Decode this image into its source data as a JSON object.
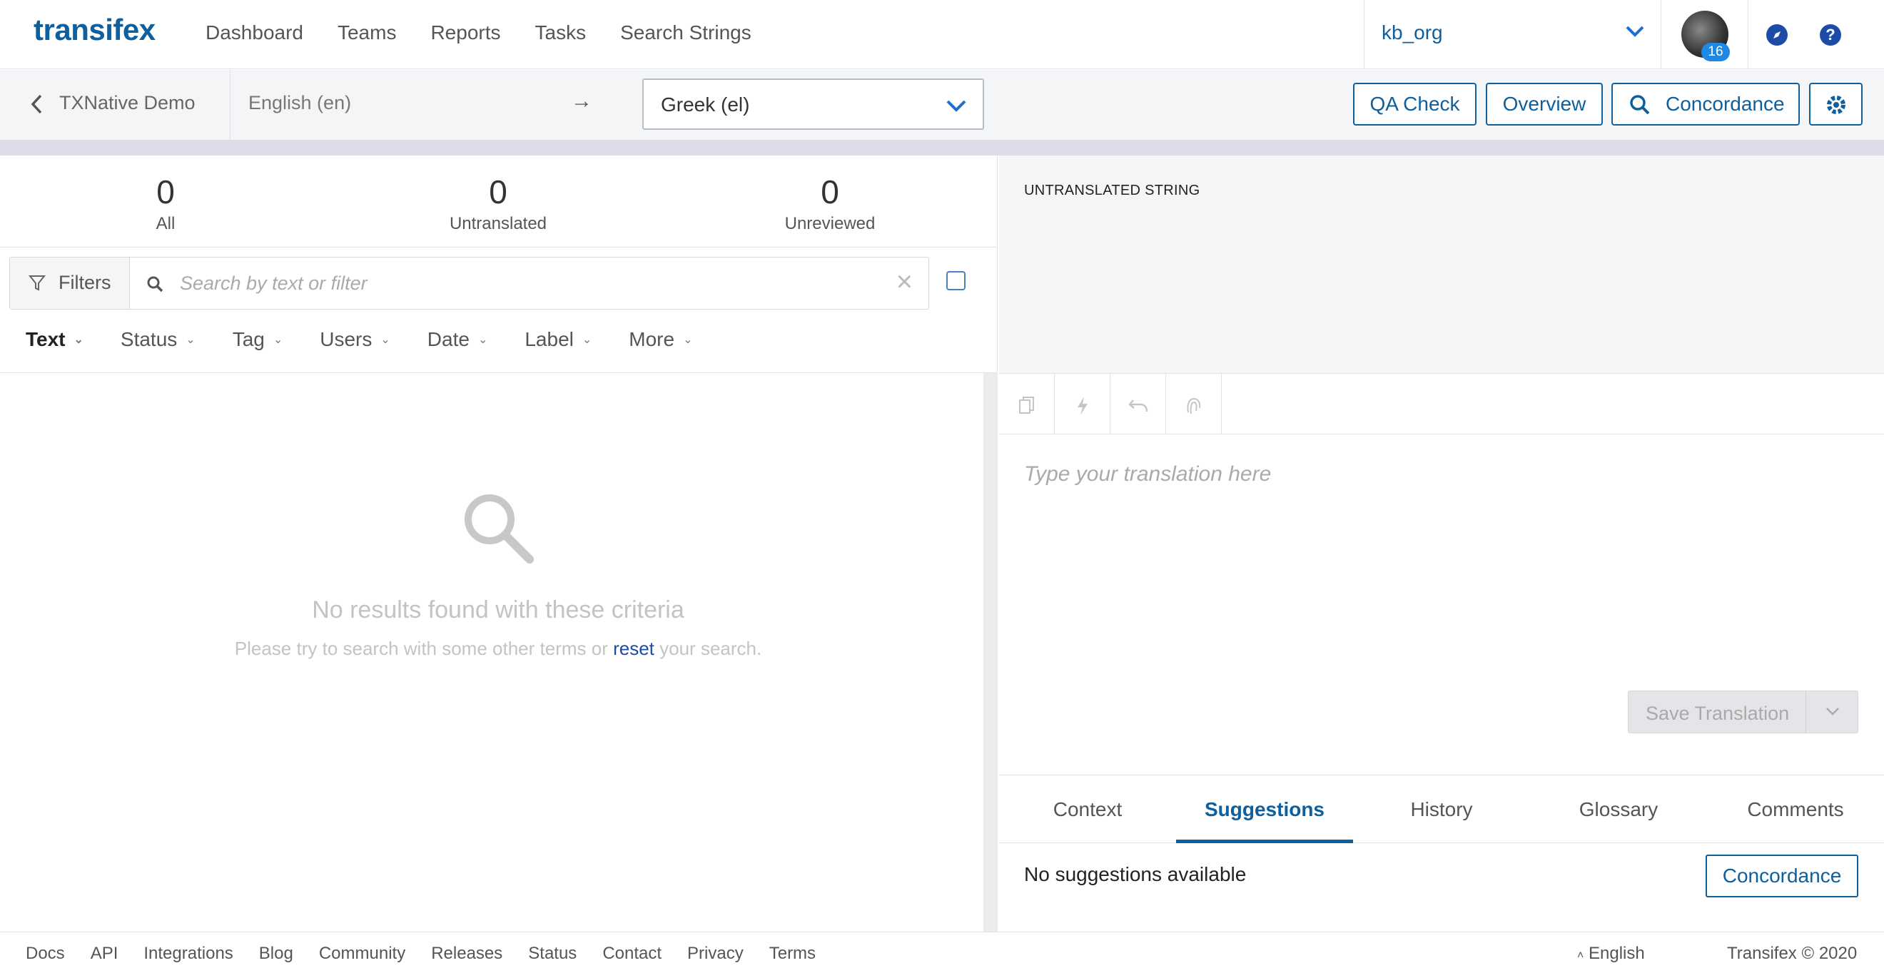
{
  "header": {
    "logo": "transifex",
    "nav": [
      "Dashboard",
      "Teams",
      "Reports",
      "Tasks",
      "Search Strings"
    ],
    "org": "kb_org",
    "avatar_badge": "16"
  },
  "subbar": {
    "project": "TXNative Demo",
    "source_lang": "English (en)",
    "arrow": "→",
    "target_lang": "Greek (el)",
    "qa_check": "QA Check",
    "overview": "Overview",
    "concordance": "Concordance"
  },
  "stats": [
    {
      "value": "0",
      "label": "All"
    },
    {
      "value": "0",
      "label": "Untranslated"
    },
    {
      "value": "0",
      "label": "Unreviewed"
    }
  ],
  "filters": {
    "button": "Filters",
    "placeholder": "Search by text or filter",
    "tabs": [
      "Text",
      "Status",
      "Tag",
      "Users",
      "Date",
      "Label",
      "More"
    ]
  },
  "empty": {
    "title": "No results found with these criteria",
    "text_before": "Please try to search with some other terms or",
    "link": "reset",
    "text_after": "your search."
  },
  "editor": {
    "source_label": "UNTRANSLATED STRING",
    "placeholder": "Type your translation here",
    "save": "Save Translation"
  },
  "tabs": [
    "Context",
    "Suggestions",
    "History",
    "Glossary",
    "Comments"
  ],
  "active_tab": "Suggestions",
  "suggestions": {
    "message": "No suggestions available",
    "concordance": "Concordance"
  },
  "footer": {
    "links": [
      "Docs",
      "API",
      "Integrations",
      "Blog",
      "Community",
      "Releases",
      "Status",
      "Contact",
      "Privacy",
      "Terms"
    ],
    "language": "English",
    "copyright": "Transifex © 2020"
  },
  "colors": {
    "brand": "#0d5f9e",
    "accent": "#1d4ca6",
    "badge": "#1e88e5"
  }
}
